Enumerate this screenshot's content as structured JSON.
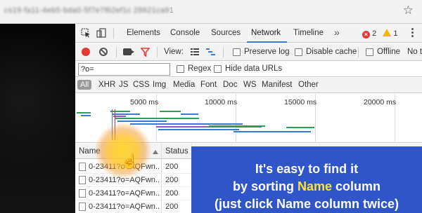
{
  "browser": {
    "url_prefix": "cs19-fa11-4eb5-bda0-5f7e7f62ef1c 28621ca9",
    "url_tail": "1"
  },
  "devtools": {
    "tabs": [
      "Elements",
      "Console",
      "Sources",
      "Network",
      "Timeline"
    ],
    "active_tab": "Network",
    "more_tabs": "»",
    "error_count": "2",
    "warning_count": "1"
  },
  "toolbar": {
    "view_label": "View:",
    "preserve_log": "Preserve log",
    "disable_cache": "Disable cache",
    "offline": "Offline",
    "throttle": "No t"
  },
  "filter": {
    "value": "?o=",
    "regex": "Regex",
    "hide_data_urls": "Hide data URLs"
  },
  "types": [
    "All",
    "XHR",
    "JS",
    "CSS",
    "Img",
    "Media",
    "Font",
    "Doc",
    "WS",
    "Manifest",
    "Other"
  ],
  "overview": {
    "ticks": [
      "5000 ms",
      "10000 ms",
      "15000 ms",
      "20000 ms"
    ]
  },
  "table": {
    "headers": {
      "name": "Name",
      "status": "Status"
    },
    "rows": [
      {
        "name": "0-23411?o=AQFwn...",
        "status": "200"
      },
      {
        "name": "0-23411?o=AQFwn...",
        "status": "200"
      },
      {
        "name": "0-23411?o=AQFwn...",
        "status": "200"
      },
      {
        "name": "0-23411?o=AQFwn...",
        "status": "200"
      }
    ]
  },
  "callout": {
    "line1": "It's easy to find it",
    "line2_pre": "by sorting ",
    "line2_hl": "Name",
    "line2_post": " column",
    "line3": "(just click Name column twice)"
  },
  "colors": {
    "callout_bg": "#2f55c8",
    "highlight": "#ffe135",
    "record": "#e53935",
    "accent": "#3879d9"
  }
}
